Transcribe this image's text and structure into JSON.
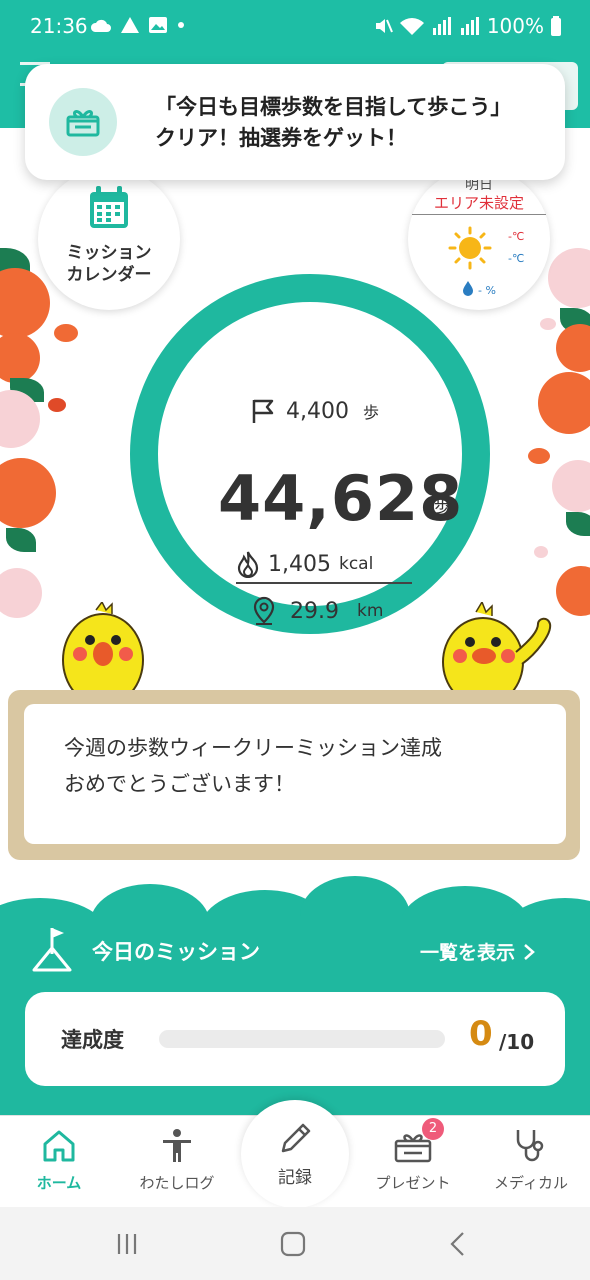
{
  "status_bar": {
    "time": "21:36",
    "battery": "100%"
  },
  "toast": {
    "message": "「今日も目標歩数を目指して歩こう」クリア！抽選券をゲット！"
  },
  "mission_calendar": {
    "label_line1": "ミッション",
    "label_line2": "カレンダー"
  },
  "weather": {
    "day": "明日",
    "area": "エリア未設定",
    "temp_high": "-℃",
    "temp_low": "-℃",
    "rain": "- %"
  },
  "stats": {
    "goal_value": "4,400",
    "goal_unit": "歩",
    "steps_value": "44,628",
    "steps_unit": "歩",
    "kcal_value": "1,405",
    "kcal_unit": "kcal",
    "distance_value": "29.9",
    "distance_unit": "km"
  },
  "message_board": {
    "line1": "今週の歩数ウィークリーミッション達成",
    "line2": "おめでとうございます！"
  },
  "mission": {
    "title": "今日のミッション",
    "show_all": "一覧を表示",
    "progress_label": "達成度",
    "progress_current": "0",
    "progress_total": "/10",
    "progress_fraction": 0.0
  },
  "bottom_nav": {
    "home": "ホーム",
    "my_log": "わたしログ",
    "record": "記録",
    "present": "プレゼント",
    "present_badge": "2",
    "medical": "メディカル"
  },
  "colors": {
    "brand": "#1fb89f",
    "accent_orange": "#d58a12",
    "alert_red": "#e0303a",
    "badge_pink": "#ef5b7a"
  }
}
